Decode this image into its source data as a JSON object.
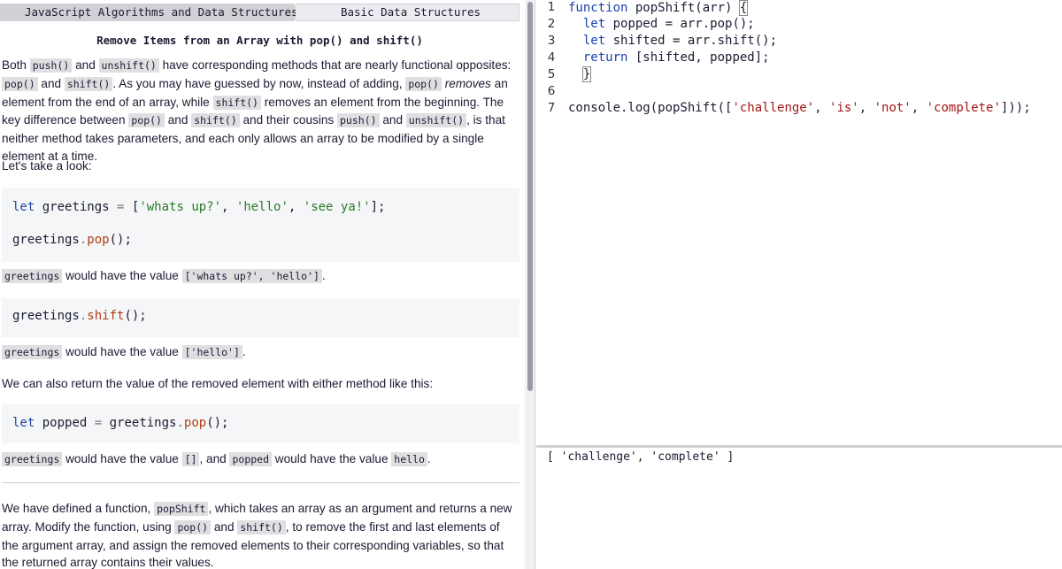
{
  "breadcrumb": {
    "section": "JavaScript Algorithms and Data Structures",
    "subsection": "Basic Data Structures"
  },
  "challenge": {
    "title": "Remove Items from an Array with pop() and shift()"
  },
  "description": {
    "p1": {
      "t1": "Both ",
      "c1": "push()",
      "t2": " and ",
      "c2": "unshift()",
      "t3": " have corresponding methods that are nearly functional opposites: ",
      "c3": "pop()",
      "t4": " and ",
      "c4": "shift()",
      "t5": ". As you may have guessed by now, instead of adding, ",
      "c5": "pop()",
      "t6": " ",
      "em1": "removes",
      "t7": " an element from the end of an array, while ",
      "c6": "shift()",
      "t8": " removes an element from the beginning. The key difference between ",
      "c7": "pop()",
      "t9": " and ",
      "c8": "shift()",
      "t10": " and their cousins ",
      "c9": "push()",
      "t11": " and ",
      "c10": "unshift()",
      "t12": ", is that neither method takes parameters, and each only allows an array to be modified by a single element at a time."
    },
    "p2": "Let's take a look:",
    "code1": {
      "let": "let",
      "var": " greetings ",
      "eq": "=",
      "open": " [",
      "s1": "'whats up?'",
      "comma1": ", ",
      "s2": "'hello'",
      "comma2": ", ",
      "s3": "'see ya!'",
      "close": "];",
      "line2_obj": "greetings",
      "line2_dot": ".",
      "line2_method": "pop",
      "line2_end": "();"
    },
    "p3": {
      "c1": "greetings",
      "t1": " would have the value ",
      "c2": "['whats up?', 'hello']",
      "t2": "."
    },
    "code2": {
      "obj": "greetings",
      "dot": ".",
      "method": "shift",
      "end": "();"
    },
    "p4": {
      "c1": "greetings",
      "t1": " would have the value ",
      "c2": "['hello']",
      "t2": "."
    },
    "p5": "We can also return the value of the removed element with either method like this:",
    "code3": {
      "let": "let",
      "var": " popped ",
      "eq": "=",
      "obj": " greetings",
      "dot": ".",
      "method": "pop",
      "end": "();"
    },
    "p6": {
      "c1": "greetings",
      "t1": " would have the value ",
      "c2": "[]",
      "t2": ", and ",
      "c3": "popped",
      "t3": " would have the value ",
      "c4": "hello",
      "t4": "."
    },
    "p7": {
      "t1": "We have defined a function, ",
      "c1": "popShift",
      "t2": ", which takes an array as an argument and returns a new array. Modify the function, using ",
      "c2": "pop()",
      "t3": " and ",
      "c3": "shift()",
      "t4": ", to remove the first and last elements of the argument array, and assign the removed elements to their corresponding variables, so that the returned array contains their values."
    }
  },
  "editor": {
    "line_numbers": [
      "1",
      "2",
      "3",
      "4",
      "5",
      "6",
      "7"
    ],
    "line1": {
      "kw": "function",
      "rest": " popShift(arr) ",
      "brace": "{"
    },
    "line2": {
      "kw": "let",
      "rest": " popped = arr.pop();"
    },
    "line3": {
      "kw": "let",
      "rest": " shifted = arr.shift();"
    },
    "line4": {
      "kw": "return",
      "rest": " [shifted, popped];"
    },
    "line5": {
      "rest": "}"
    },
    "line6": {
      "rest": ""
    },
    "line7": {
      "pre": "console.log(popShift([",
      "s1": "'challenge'",
      "c1": ", ",
      "s2": "'is'",
      "c2": ", ",
      "s3": "'not'",
      "c3": ", ",
      "s4": "'complete'",
      "post": "]));"
    }
  },
  "console": {
    "output": "[ 'challenge', 'complete' ]"
  },
  "colors": {
    "keyword": "#1a3fb0",
    "string": "#a31515",
    "inline_code_bg": "#dfdfe2",
    "code_block_bg": "#f5f6f7"
  }
}
